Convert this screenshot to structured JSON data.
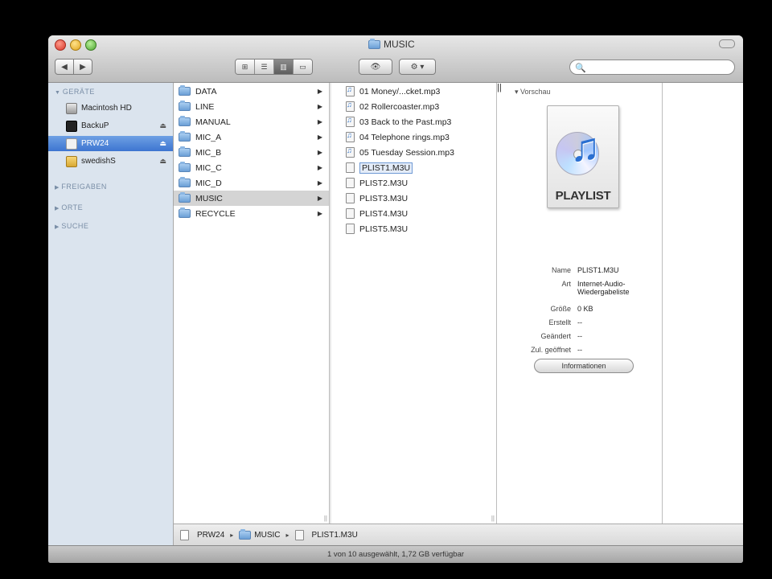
{
  "window": {
    "title": "MUSIC"
  },
  "toolbar": {
    "back": "◀",
    "forward": "▶",
    "view_modes": [
      "⊞",
      "☰",
      "▥",
      "▭"
    ],
    "quicklook": "👁",
    "action": "⚙ ▾",
    "search_icon": "🔍",
    "search_value": ""
  },
  "sidebar": {
    "sections": [
      {
        "label": "GERÄTE"
      },
      {
        "label": "FREIGABEN"
      },
      {
        "label": "ORTE"
      },
      {
        "label": "SUCHE"
      }
    ],
    "devices": [
      {
        "label": "Macintosh HD",
        "icon": "harddisk-icon",
        "eject": ""
      },
      {
        "label": "BackuP",
        "icon": "external-disk-icon",
        "eject": "⏏"
      },
      {
        "label": "PRW24",
        "icon": "usb-drive-icon",
        "eject": "⏏"
      },
      {
        "label": "swedishS",
        "icon": "usb-drive-icon",
        "eject": "⏏"
      }
    ]
  },
  "column1": {
    "items": [
      {
        "label": "DATA"
      },
      {
        "label": "LINE"
      },
      {
        "label": "MANUAL"
      },
      {
        "label": "MIC_A"
      },
      {
        "label": "MIC_B"
      },
      {
        "label": "MIC_C"
      },
      {
        "label": "MIC_D"
      },
      {
        "label": "MUSIC"
      },
      {
        "label": "RECYCLE"
      }
    ],
    "arrow": "▶"
  },
  "column2": {
    "items": [
      {
        "label": "01 Money/...cket.mp3"
      },
      {
        "label": "02 Rollercoaster.mp3"
      },
      {
        "label": "03 Back to the Past.mp3"
      },
      {
        "label": "04 Telephone rings.mp3"
      },
      {
        "label": "05 Tuesday Session.mp3"
      },
      {
        "label": "PLIST1.M3U"
      },
      {
        "label": "PLIST2.M3U"
      },
      {
        "label": "PLIST3.M3U"
      },
      {
        "label": "PLIST4.M3U"
      },
      {
        "label": "PLIST5.M3U"
      }
    ]
  },
  "preview": {
    "header": "Vorschau",
    "icon_label": "PLAYLIST",
    "fields": [
      {
        "key": "Name",
        "value": "PLIST1.M3U"
      },
      {
        "key": "Art",
        "value": "Internet-Audio-Wiedergabeliste"
      },
      {
        "key": "Größe",
        "value": "0 KB"
      },
      {
        "key": "Erstellt",
        "value": "--"
      },
      {
        "key": "Geändert",
        "value": "--"
      },
      {
        "key": "Zul. geöffnet",
        "value": "--"
      }
    ],
    "info_button": "Informationen"
  },
  "pathbar": {
    "items": [
      "PRW24",
      "MUSIC",
      "PLIST1.M3U"
    ],
    "sep": "▸"
  },
  "status": "1 von 10 ausgewählt, 1,72 GB verfügbar",
  "colors": {
    "selection": "#3d75d1",
    "sidebar_bg": "#dbe4ee",
    "folder": "#6b9fd6"
  }
}
